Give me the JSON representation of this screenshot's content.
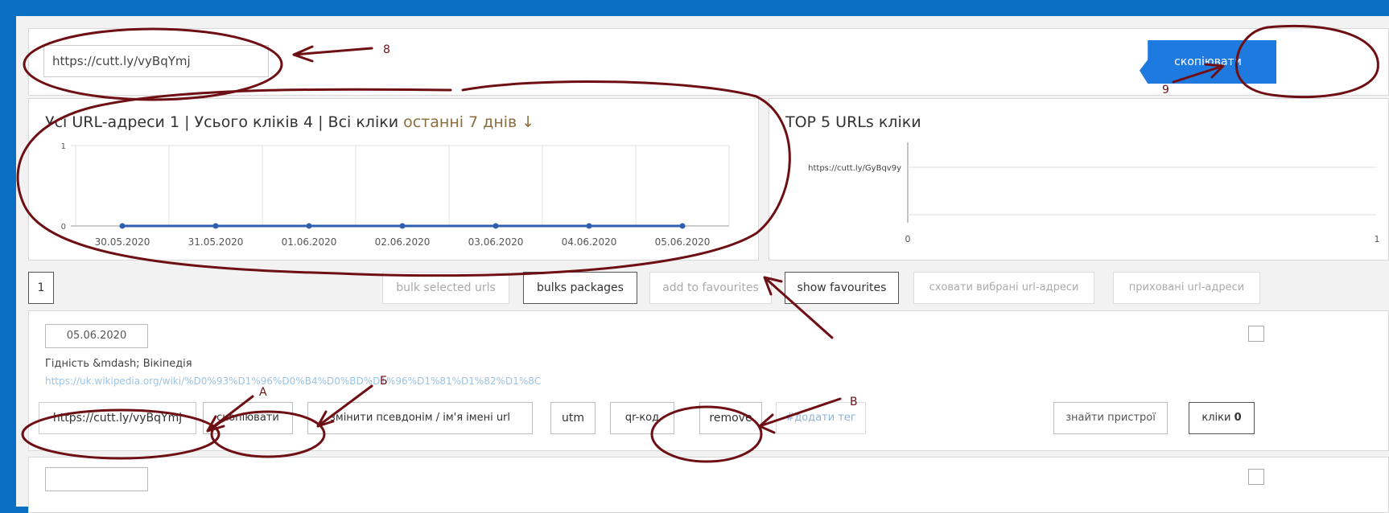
{
  "short_url_bar": {
    "url": "https://cutt.ly/vyBqYmj",
    "copy_label": "скопіювати"
  },
  "stats": {
    "title_prefix": "Усі URL-адреси",
    "total_urls": "1",
    "sep1": "|",
    "clicks_prefix": "Усього кліків",
    "total_clicks": "4",
    "sep2": "|",
    "all_clicks": "Всі кліки",
    "period": "останні 7 днів ↓"
  },
  "chart_data": [
    {
      "type": "line",
      "title": "",
      "x": [
        "30.05.2020",
        "31.05.2020",
        "01.06.2020",
        "02.06.2020",
        "03.06.2020",
        "04.06.2020",
        "05.06.2020"
      ],
      "series": [
        {
          "values": [
            0,
            0,
            0,
            0,
            0,
            0,
            0
          ]
        }
      ],
      "y_ticks": [
        "0",
        "1"
      ],
      "ylim": [
        0,
        1
      ],
      "grid": true,
      "colors": {
        "line": "#2f5fb0"
      }
    },
    {
      "type": "bar",
      "title": "TOP 5 URLs кліки",
      "categories": [
        "https://cutt.ly/GyBqv9y"
      ],
      "values": [
        0
      ],
      "x_ticks": [
        "0",
        "1"
      ],
      "xlim": [
        0,
        1
      ]
    }
  ],
  "toolbar": {
    "page_number": "1",
    "bulk_selected": "bulk selected urls",
    "bulks_packages": "bulks packages",
    "add_favourites": "add to favourites",
    "show_favourites": "show favourites",
    "hide_selected": "сховати вибрані url-адреси",
    "hidden_urls": "приховані url-адреси"
  },
  "link_item": {
    "date": "05.06.2020",
    "title": "Гідність &mdash; Вікіпедія",
    "long_url": "https://uk.wikipedia.org/wiki/%D0%93%D1%96%D0%B4%D0%BD%D1%96%D1%81%D1%82%D1%8C",
    "short_url": "https://cutt.ly/vyBqYmj",
    "copy_label": "скопіювати",
    "change_alias": "змінити псевдонім / ім'я імені url",
    "utm": "utm",
    "qr": "qr-код",
    "remove": "remove",
    "add_tag": "#додати тег",
    "find_devices": "знайти пристрої",
    "clicks_label": "кліки",
    "clicks_count": "0"
  },
  "annotations": {
    "label_8": "8",
    "label_9": "9",
    "label_a": "А",
    "label_b": "Б",
    "label_v": "В",
    "ink_color": "#6e0f14"
  },
  "colors": {
    "frame": "#0a6fc2",
    "copy_button": "#1f7ae0",
    "link": "#2f7fc1"
  }
}
